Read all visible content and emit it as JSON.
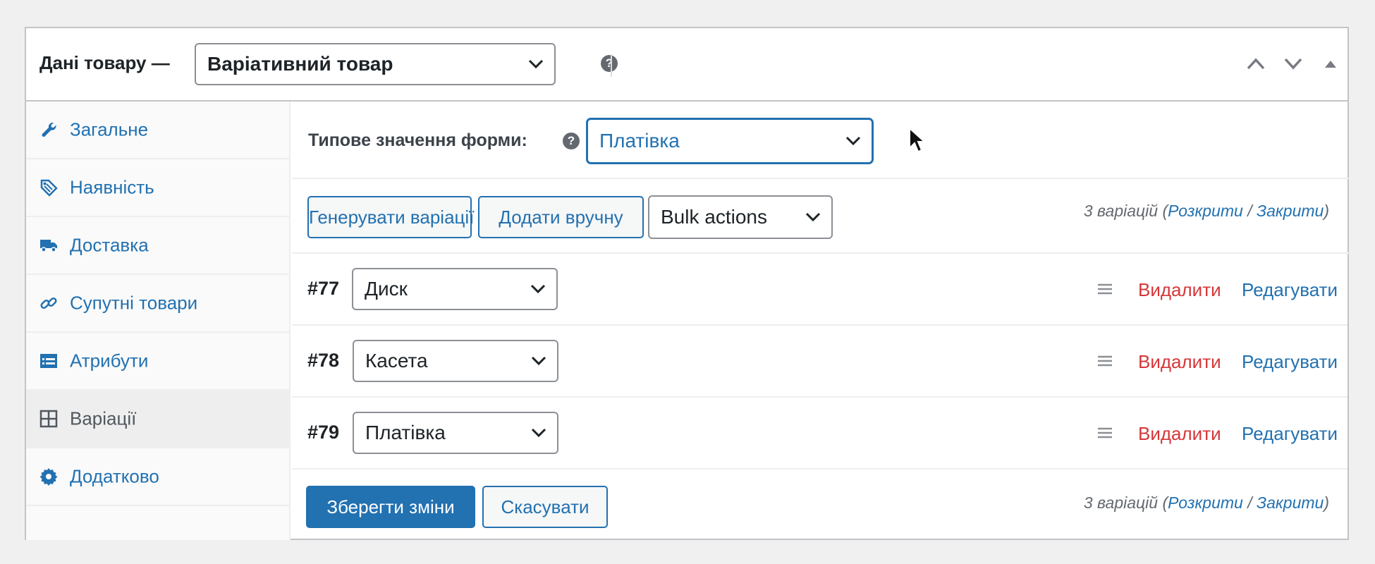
{
  "header": {
    "title": "Дані товару —",
    "product_type": "Варіативний товар"
  },
  "sidebar": {
    "items": [
      {
        "label": "Загальне",
        "icon": "wrench-icon"
      },
      {
        "label": "Наявність",
        "icon": "tag-icon"
      },
      {
        "label": "Доставка",
        "icon": "truck-icon"
      },
      {
        "label": "Супутні товари",
        "icon": "link-icon"
      },
      {
        "label": "Атрибути",
        "icon": "list-icon"
      },
      {
        "label": "Варіації",
        "icon": "grid-icon",
        "active": true
      },
      {
        "label": "Додатково",
        "icon": "gear-icon"
      }
    ]
  },
  "default_form": {
    "label": "Типове значення форми:",
    "value": "Платівка"
  },
  "toolbar": {
    "generate_label": "Генерувати варіації",
    "add_manual_label": "Додати вручну",
    "bulk_actions": "Bulk actions"
  },
  "count": {
    "text": "3 варіацій",
    "open_paren": "(",
    "expand": "Розкрити",
    "slash": "/",
    "collapse": "Закрити",
    "close_paren": ")"
  },
  "variations": [
    {
      "id": "#77",
      "value": "Диск"
    },
    {
      "id": "#78",
      "value": "Касета"
    },
    {
      "id": "#79",
      "value": "Платівка"
    }
  ],
  "row_actions": {
    "delete": "Видалити",
    "edit": "Редагувати"
  },
  "footer": {
    "save_label": "Зберегти зміни",
    "cancel_label": "Скасувати"
  },
  "help_glyph": "?",
  "colors": {
    "link": "#2271b1",
    "delete": "#d63638",
    "primary": "#2271b1"
  }
}
